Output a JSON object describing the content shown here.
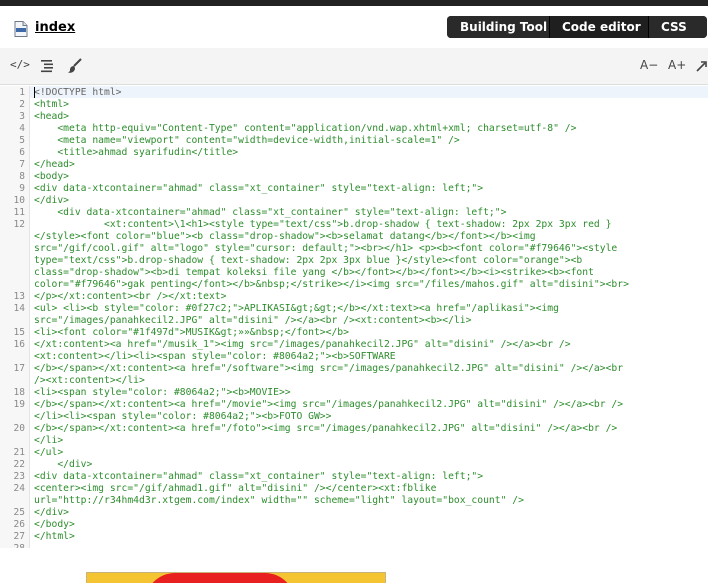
{
  "file": {
    "title": "index",
    "icon": "file-icon"
  },
  "tabs": [
    {
      "label": "Building Tool"
    },
    {
      "label": "Code editor"
    },
    {
      "label": "CSS"
    }
  ],
  "toolbar": {
    "code_view_label": "</>",
    "font_smaller_label": "A−",
    "font_larger_label": "A+"
  },
  "editor": {
    "lines": [
      {
        "n": "1",
        "rows": [
          "<!DOCTYPE html>"
        ]
      },
      {
        "n": "2",
        "rows": [
          "<html>"
        ]
      },
      {
        "n": "3",
        "rows": [
          "<head>"
        ]
      },
      {
        "n": "4",
        "rows": [
          "    <meta http-equiv=\"Content-Type\" content=\"application/vnd.wap.xhtml+xml; charset=utf-8\" />"
        ]
      },
      {
        "n": "5",
        "rows": [
          "    <meta name=\"viewport\" content=\"width=device-width,initial-scale=1\" />"
        ]
      },
      {
        "n": "6",
        "rows": [
          "    <title>ahmad syarifudin</title>"
        ]
      },
      {
        "n": "7",
        "rows": [
          "</head>"
        ]
      },
      {
        "n": "8",
        "rows": [
          "<body>"
        ]
      },
      {
        "n": "9",
        "rows": [
          "<div data-xtcontainer=\"ahmad\" class=\"xt_container\" style=\"text-align: left;\">"
        ]
      },
      {
        "n": "10",
        "rows": [
          "</div>"
        ]
      },
      {
        "n": "11",
        "rows": [
          "    <div data-xtcontainer=\"ahmad\" class=\"xt_container\" style=\"text-align: left;\">"
        ]
      },
      {
        "n": "12",
        "rows": [
          "            <xt:content>\\1<h1><style type=\"text/css\">b.drop-shadow { text-shadow: 2px 2px 3px red }",
          "</style><font color=\"blue\"><b class=\"drop-shadow\"><b>selamat datang</b></font></b><img",
          "src=\"/gif/cool.gif\" alt=\"logo\" style=\"cursor: default;\"><br></h1> <p><b><font color=\"#f79646\"><style",
          "type=\"text/css\">b.drop-shadow { text-shadow: 2px 2px 3px blue }</style><font color=\"orange\"><b",
          "class=\"drop-shadow\"><b>di tempat koleksi file yang </b></font></b></font></b><i><strike><b><font",
          "color=\"#f79646\">gak penting</font></b>&nbsp;</strike></i><img src=\"/files/mahos.gif\" alt=\"disini\"><br>"
        ]
      },
      {
        "n": "13",
        "rows": [
          "</p></xt:content><br /></xt:text>"
        ]
      },
      {
        "n": "14",
        "rows": [
          "<ul> <li><b style=\"color: #0f27c2;\">APLIKASI&gt;&gt;</b></xt:text><a href=\"/aplikasi\"><img",
          "src=\"/images/panahkecil2.JPG\" alt=\"disini\" /></a><br /><xt:content><b></li>"
        ]
      },
      {
        "n": "15",
        "rows": [
          "<li><font color=\"#1f497d\">MUSIK&gt;»»&nbsp;</font></b>"
        ]
      },
      {
        "n": "16",
        "rows": [
          "</xt:content><a href=\"/musik_1\"><img src=\"/images/panahkecil2.JPG\" alt=\"disini\" /></a><br />",
          "<xt:content></li><li><span style=\"color: #8064a2;\"><b>SOFTWARE"
        ]
      },
      {
        "n": "17",
        "rows": [
          "</b></span></xt:content><a href=\"/software\"><img src=\"/images/panahkecil2.JPG\" alt=\"disini\" /></a><br",
          "/><xt:content></li>"
        ]
      },
      {
        "n": "18",
        "rows": [
          "<li><span style=\"color: #8064a2;\"><b>MOVIE>>"
        ]
      },
      {
        "n": "19",
        "rows": [
          "</b></span></xt:content><a href=\"/movie\"><img src=\"/images/panahkecil2.JPG\" alt=\"disini\" /></a><br />",
          "</li><li><span style=\"color: #8064a2;\"><b>FOTO GW>>"
        ]
      },
      {
        "n": "20",
        "rows": [
          "</b></span></xt:content><a href=\"/foto\"><img src=\"/images/panahkecil2.JPG\" alt=\"disini\" /></a><br />",
          "</li>"
        ]
      },
      {
        "n": "21",
        "rows": [
          "</ul>"
        ]
      },
      {
        "n": "22",
        "rows": [
          "    </div>"
        ]
      },
      {
        "n": "23",
        "rows": [
          "<div data-xtcontainer=\"ahmad\" class=\"xt_container\" style=\"text-align: left;\">"
        ]
      },
      {
        "n": "24",
        "rows": [
          "<center><img src=\"/gif/ahmad1.gif\" alt=\"disini\" /></center><xt:fblike",
          "url=\"http://r34hm4d3r.xtgem.com/index\" width=\"\" scheme=\"light\" layout=\"box_count\" />"
        ]
      },
      {
        "n": "25",
        "rows": [
          "</div>"
        ]
      },
      {
        "n": "26",
        "rows": [
          "</body>"
        ]
      },
      {
        "n": "27",
        "rows": [
          "</html>"
        ]
      },
      {
        "n": "28",
        "rows": [
          ""
        ]
      }
    ]
  },
  "colors": {
    "code_text": "#2d8d2d",
    "header_bg": "#ffffff",
    "tab_bg": "#2a2a2a"
  }
}
